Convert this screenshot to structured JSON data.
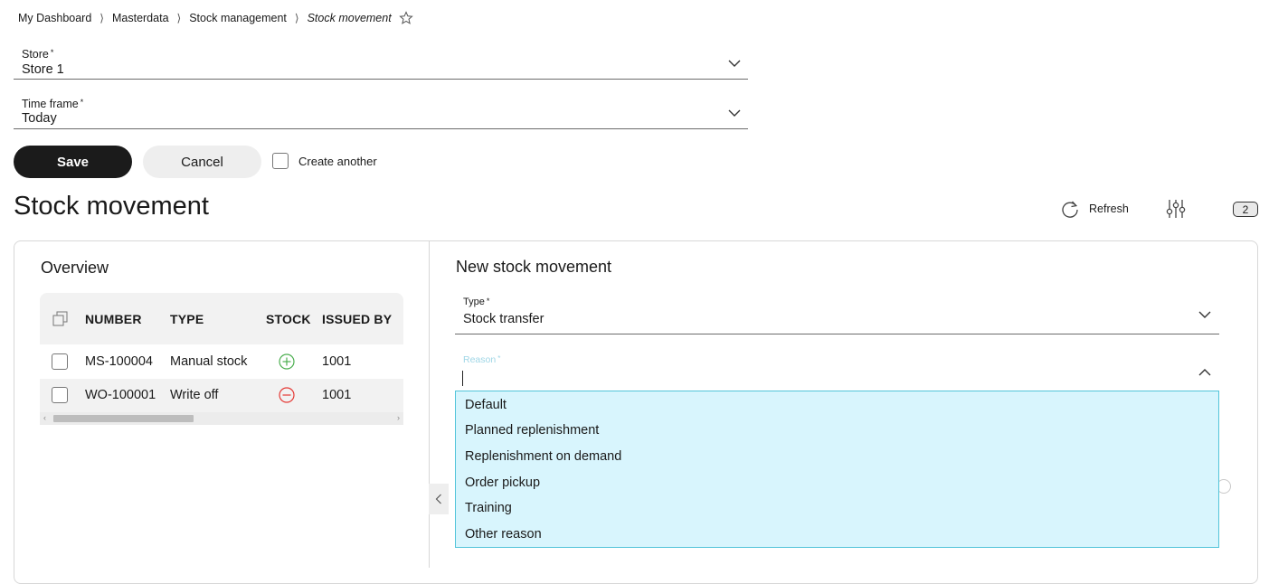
{
  "breadcrumb": {
    "items": [
      "My Dashboard",
      "Masterdata",
      "Stock management"
    ],
    "current": "Stock movement",
    "separator": "⟩"
  },
  "filters": {
    "store": {
      "label": "Store",
      "required_mark": "*",
      "value": "Store 1"
    },
    "time_frame": {
      "label": "Time frame",
      "required_mark": "*",
      "value": "Today"
    }
  },
  "actions": {
    "save_label": "Save",
    "cancel_label": "Cancel",
    "create_another_label": "Create another",
    "create_another_checked": false
  },
  "page": {
    "title": "Stock movement",
    "refresh_label": "Refresh",
    "count_badge": "2"
  },
  "overview": {
    "title": "Overview",
    "columns": [
      "NUMBER",
      "TYPE",
      "STOCK",
      "ISSUED BY"
    ],
    "rows": [
      {
        "number": "MS-100004",
        "type": "Manual stock",
        "stock": "plus-circle-icon",
        "issued_by": "1001"
      },
      {
        "number": "WO-100001",
        "type": "Write off",
        "stock": "minus-circle-icon",
        "issued_by": "1001"
      }
    ]
  },
  "new_movement": {
    "title": "New stock movement",
    "type_field": {
      "label": "Type",
      "required_mark": "*",
      "value": "Stock transfer"
    },
    "reason_field": {
      "label": "Reason",
      "required_mark": "*",
      "value": ""
    },
    "reason_options": [
      "Default",
      "Planned replenishment",
      "Replenishment on demand",
      "Order pickup",
      "Training",
      "Other reason"
    ]
  },
  "colors": {
    "primary_button": "#1b1b1b",
    "dropdown_bg": "#d8f5fd",
    "dropdown_border": "#52c4d9",
    "plus_green": "#4caf50",
    "minus_red": "#e53935"
  }
}
